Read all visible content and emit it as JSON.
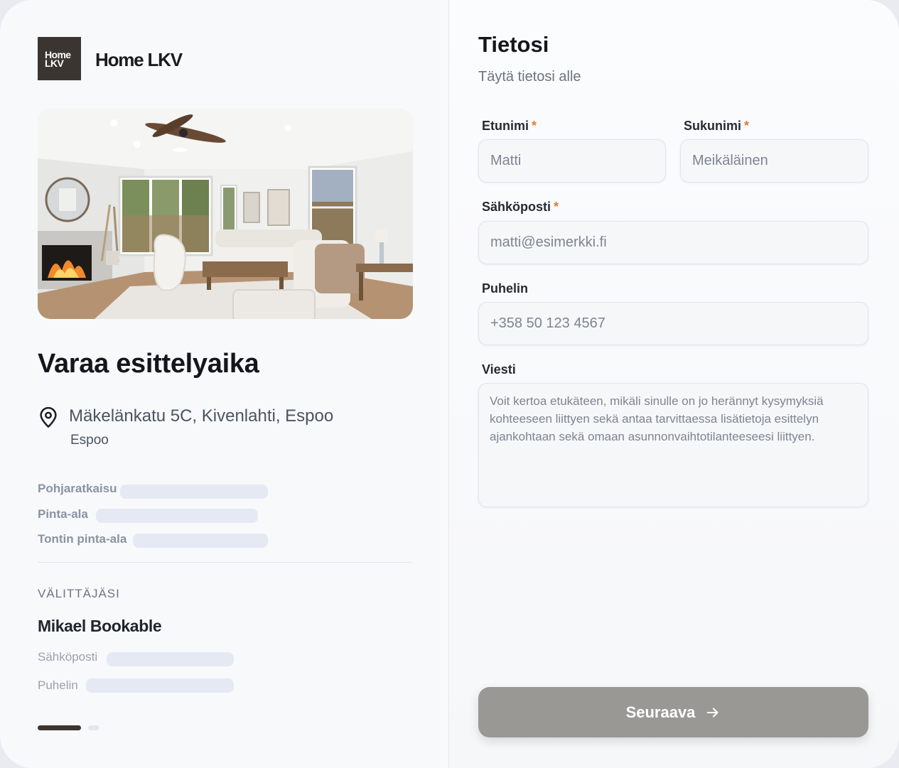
{
  "brand": {
    "logo_mark_line1": "Home",
    "logo_mark_line2": "LKV",
    "name": "Home LKV"
  },
  "property": {
    "image_alt": "Olohuone",
    "heading": "Varaa esittelyaika",
    "address": "Mäkelänkatu 5C, Kivenlahti, Espoo",
    "city": "Espoo",
    "details": [
      {
        "label": "Pohjaratkaisu"
      },
      {
        "label": "Pinta-ala"
      },
      {
        "label": "Tontin pinta-ala"
      }
    ]
  },
  "agent": {
    "section_heading": "VÄLITTÄJÄSI",
    "name": "Mikael Bookable",
    "email_label": "Sähköposti",
    "phone_label": "Puhelin"
  },
  "pagination": {
    "current": 1,
    "total": 2
  },
  "form": {
    "title": "Tietosi",
    "subtitle": "Täytä tietosi alle",
    "required_mark": "*",
    "first_name": {
      "label": "Etunimi",
      "placeholder": "Matti",
      "value": ""
    },
    "last_name": {
      "label": "Sukunimi",
      "placeholder": "Meikäläinen",
      "value": ""
    },
    "email": {
      "label": "Sähköposti",
      "placeholder": "matti@esimerkki.fi",
      "value": ""
    },
    "phone": {
      "label": "Puhelin",
      "placeholder": "+358 50 123 4567",
      "value": ""
    },
    "message": {
      "label": "Viesti",
      "placeholder": "Voit kertoa etukäteen, mikäli sinulle on jo herännyt kysymyksiä kohteeseen liittyen sekä antaa tarvittaessa lisätietoja esittelyn ajankohtaan sekä omaan asunnonvaihtotilanteeseesi liittyen.",
      "value": ""
    },
    "submit_label": "Seuraava"
  },
  "colors": {
    "brand_dark": "#3b3531",
    "required": "#e07b39",
    "button_disabled": "#9a9894",
    "skeleton": "#e4e9f3"
  },
  "icons": {
    "location": "map-pin-icon",
    "next": "arrow-right-icon"
  }
}
